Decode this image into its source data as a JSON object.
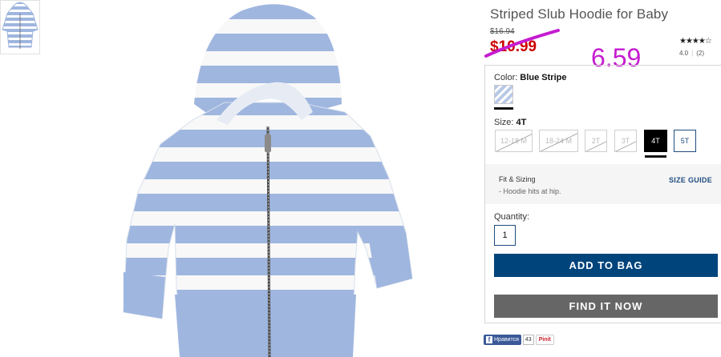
{
  "product": {
    "title": "Striped Slub Hoodie for Baby",
    "old_price": "$16.94",
    "sale_price": "$10.99",
    "handwritten_price": "6.59",
    "rating": {
      "stars": "★★★★☆",
      "value": "4.0",
      "count": "(2)"
    }
  },
  "color": {
    "label": "Color:",
    "value": "Blue Stripe",
    "swatch_name": "blue-stripe"
  },
  "size": {
    "label": "Size:",
    "value": "4T",
    "options": [
      {
        "label": "12-18 M",
        "state": "unavailable"
      },
      {
        "label": "18-24 M",
        "state": "unavailable"
      },
      {
        "label": "2T",
        "state": "unavailable"
      },
      {
        "label": "3T",
        "state": "unavailable"
      },
      {
        "label": "4T",
        "state": "selected"
      },
      {
        "label": "5T",
        "state": "available"
      }
    ]
  },
  "fit": {
    "title": "Fit & Sizing",
    "detail": "- Hoodie hits at hip.",
    "guide_link": "SIZE GUIDE"
  },
  "quantity": {
    "label": "Quantity:",
    "value": "1"
  },
  "actions": {
    "add_to_bag": "ADD TO BAG",
    "find_it_now": "FIND IT NOW"
  },
  "social": {
    "fb_label": "Нравится",
    "fb_count": "43",
    "pin_label": "Pinit"
  },
  "colors": {
    "sale_red": "#cc0000",
    "navy": "#00447c",
    "annotation": "#c51bd0",
    "stripe_blue": "#9fb6df"
  }
}
